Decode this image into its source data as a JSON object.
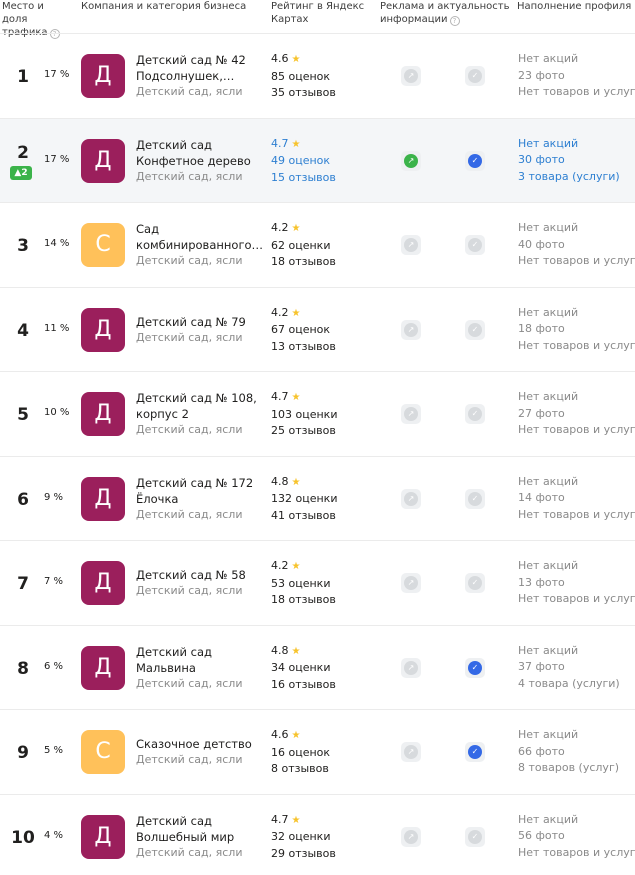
{
  "header": {
    "rank_share": "Место и доля трафика",
    "company": "Компания и категория бизнеса",
    "rating": "Рейтинг в Яндекс Картах",
    "ads": "Реклама и актуальность информации",
    "profile": "Наполнение профиля",
    "help_glyph": "?"
  },
  "colors": {
    "purple": "#9b1f5c",
    "orange": "#ffc15a",
    "blue": "#2d7fd1",
    "green": "#3bb34a"
  },
  "rows": [
    {
      "rank": "1",
      "share": "17 %",
      "letter": "Д",
      "color": "#9b1f5c",
      "name1": "Детский сад № 42",
      "name2": "Подсолнушек,…",
      "category": "Детский сад, ясли",
      "rating": "4.6",
      "reviews_count": "85 оценок",
      "reviews": "35 отзывов",
      "promo": "Нет акций",
      "photos": "23 фото",
      "goods": "Нет товаров и услуг",
      "ad": false,
      "actual": false
    },
    {
      "rank": "2",
      "badge": "▲2",
      "share": "17 %",
      "letter": "Д",
      "color": "#9b1f5c",
      "name1": "Детский сад",
      "name2": "Конфетное дерево",
      "category": "Детский сад, ясли",
      "rating": "4.7",
      "reviews_count": "49 оценок",
      "reviews": "15 отзывов",
      "promo": "Нет акций",
      "photos": "30 фото",
      "goods": "3 товара (услуги)",
      "ad": true,
      "actual": true,
      "highlight": true
    },
    {
      "rank": "3",
      "share": "14 %",
      "letter": "С",
      "color": "#ffc15a",
      "name1": "Сад",
      "name2": "комбинированного…",
      "category": "Детский сад, ясли",
      "rating": "4.2",
      "reviews_count": "62 оценки",
      "reviews": "18 отзывов",
      "promo": "Нет акций",
      "photos": "40 фото",
      "goods": "Нет товаров и услуг",
      "ad": false,
      "actual": false
    },
    {
      "rank": "4",
      "share": "11 %",
      "letter": "Д",
      "color": "#9b1f5c",
      "name1": "Детский сад № 79",
      "name2": "",
      "category": "Детский сад, ясли",
      "rating": "4.2",
      "reviews_count": "67 оценок",
      "reviews": "13 отзывов",
      "promo": "Нет акций",
      "photos": "18 фото",
      "goods": "Нет товаров и услуг",
      "ad": false,
      "actual": false
    },
    {
      "rank": "5",
      "share": "10 %",
      "letter": "Д",
      "color": "#9b1f5c",
      "name1": "Детский сад № 108,",
      "name2": "корпус 2",
      "category": "Детский сад, ясли",
      "rating": "4.7",
      "reviews_count": "103 оценки",
      "reviews": "25 отзывов",
      "promo": "Нет акций",
      "photos": "27 фото",
      "goods": "Нет товаров и услуг",
      "ad": false,
      "actual": false
    },
    {
      "rank": "6",
      "share": "9 %",
      "letter": "Д",
      "color": "#9b1f5c",
      "name1": "Детский сад № 172",
      "name2": "Ёлочка",
      "category": "Детский сад, ясли",
      "rating": "4.8",
      "reviews_count": "132 оценки",
      "reviews": "41 отзывов",
      "promo": "Нет акций",
      "photos": "14 фото",
      "goods": "Нет товаров и услуг",
      "ad": false,
      "actual": false
    },
    {
      "rank": "7",
      "share": "7 %",
      "letter": "Д",
      "color": "#9b1f5c",
      "name1": "Детский сад № 58",
      "name2": "",
      "category": "Детский сад, ясли",
      "rating": "4.2",
      "reviews_count": "53 оценки",
      "reviews": "18 отзывов",
      "promo": "Нет акций",
      "photos": "13 фото",
      "goods": "Нет товаров и услуг",
      "ad": false,
      "actual": false
    },
    {
      "rank": "8",
      "share": "6 %",
      "letter": "Д",
      "color": "#9b1f5c",
      "name1": "Детский сад",
      "name2": "Мальвина",
      "category": "Детский сад, ясли",
      "rating": "4.8",
      "reviews_count": "34 оценки",
      "reviews": "16 отзывов",
      "promo": "Нет акций",
      "photos": "37 фото",
      "goods": "4 товара (услуги)",
      "ad": false,
      "actual": true
    },
    {
      "rank": "9",
      "share": "5 %",
      "letter": "С",
      "color": "#ffc15a",
      "name1": "Сказочное детство",
      "name2": "",
      "category": "Детский сад, ясли",
      "rating": "4.6",
      "reviews_count": "16 оценок",
      "reviews": "8 отзывов",
      "promo": "Нет акций",
      "photos": "66 фото",
      "goods": "8 товаров (услуг)",
      "ad": false,
      "actual": true
    },
    {
      "rank": "10",
      "share": "4 %",
      "letter": "Д",
      "color": "#9b1f5c",
      "name1": "Детский сад",
      "name2": "Волшебный мир",
      "category": "Детский сад, ясли",
      "rating": "4.7",
      "reviews_count": "32 оценки",
      "reviews": "29 отзывов",
      "promo": "Нет акций",
      "photos": "56 фото",
      "goods": "Нет товаров и услуг",
      "ad": false,
      "actual": false
    }
  ]
}
